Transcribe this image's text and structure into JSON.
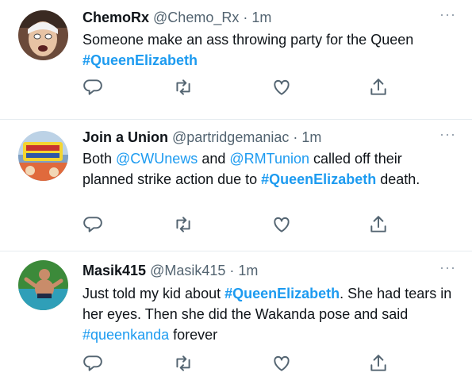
{
  "colors": {
    "link": "#1d9bf0",
    "secondary": "#536471",
    "text": "#0f1419"
  },
  "tweets": [
    {
      "name": "ChemoRx",
      "handle": "@Chemo_Rx",
      "dot": "·",
      "time": "1m",
      "more": "···",
      "body": {
        "line1": "Someone make an ass throwing party for the Queen",
        "hashtag": "#QueenElizabeth"
      }
    },
    {
      "name": "Join a Union",
      "handle": "@partridgemaniac",
      "dot": "·",
      "time": "1m",
      "more": "···",
      "body": {
        "p1": "Both ",
        "mention1": "@CWUnews",
        "p2": " and ",
        "mention2": "@RMTunion",
        "p3": " called off their planned strike action due to ",
        "hashtag": "#QueenElizabeth",
        "p4": " death."
      }
    },
    {
      "name": "Masik415",
      "handle": "@Masik415",
      "dot": "·",
      "time": "1m",
      "more": "···",
      "body": {
        "p1": "Just told my kid about ",
        "hashtag1": "#QueenElizabeth",
        "p2": ". She had tears in her eyes. Then she did the Wakanda pose and said ",
        "hashtag2": "#queenkanda",
        "p3": " forever"
      }
    }
  ],
  "icons": [
    "reply-icon",
    "retweet-icon",
    "like-icon",
    "share-icon"
  ]
}
